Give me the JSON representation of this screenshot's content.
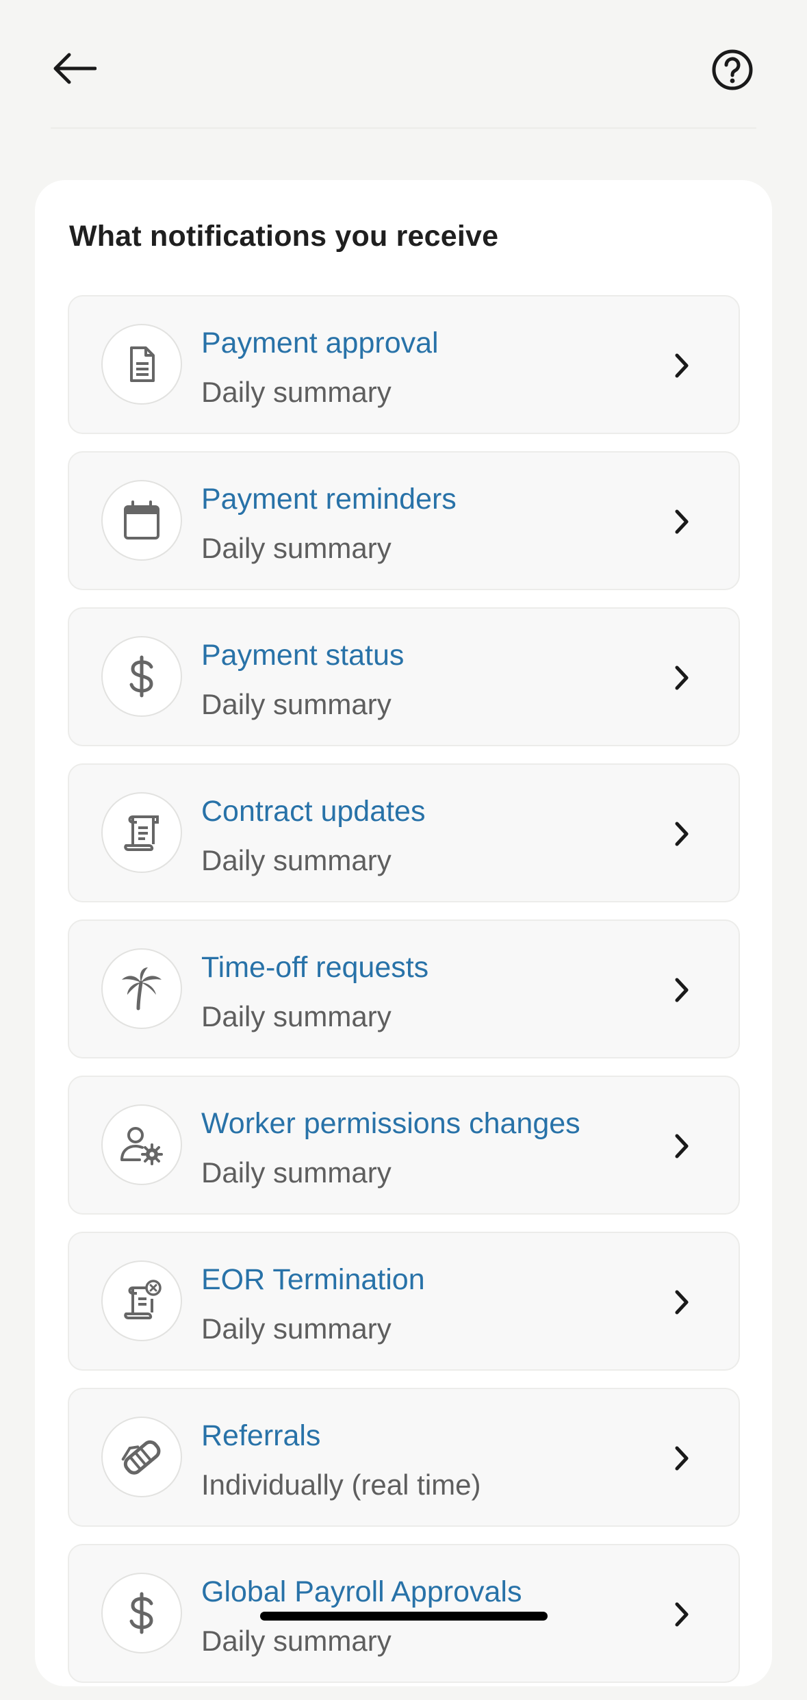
{
  "header": {
    "back_icon": "arrow-left-icon",
    "help_icon": "question-circle-icon"
  },
  "card": {
    "title": "What notifications you receive"
  },
  "notifications": [
    {
      "title": "Payment approval",
      "subtitle": "Daily summary",
      "icon": "document-icon"
    },
    {
      "title": "Payment reminders",
      "subtitle": "Daily summary",
      "icon": "calendar-icon"
    },
    {
      "title": "Payment status",
      "subtitle": "Daily summary",
      "icon": "dollar-icon"
    },
    {
      "title": "Contract updates",
      "subtitle": "Daily summary",
      "icon": "contract-scroll-icon"
    },
    {
      "title": "Time-off requests",
      "subtitle": "Daily summary",
      "icon": "palm-tree-icon"
    },
    {
      "title": "Worker permissions changes",
      "subtitle": "Daily summary",
      "icon": "user-gear-icon"
    },
    {
      "title": "EOR Termination",
      "subtitle": "Daily summary",
      "icon": "contract-cancel-icon"
    },
    {
      "title": "Referrals",
      "subtitle": "Individually (real time)",
      "icon": "handshake-icon"
    },
    {
      "title": "Global Payroll Approvals",
      "subtitle": "Daily summary",
      "icon": "dollar-icon"
    }
  ],
  "colors": {
    "title_link": "#2872a8",
    "subtitle": "#5e5e5e",
    "background": "#f5f5f3",
    "icon_gray": "#666666"
  }
}
